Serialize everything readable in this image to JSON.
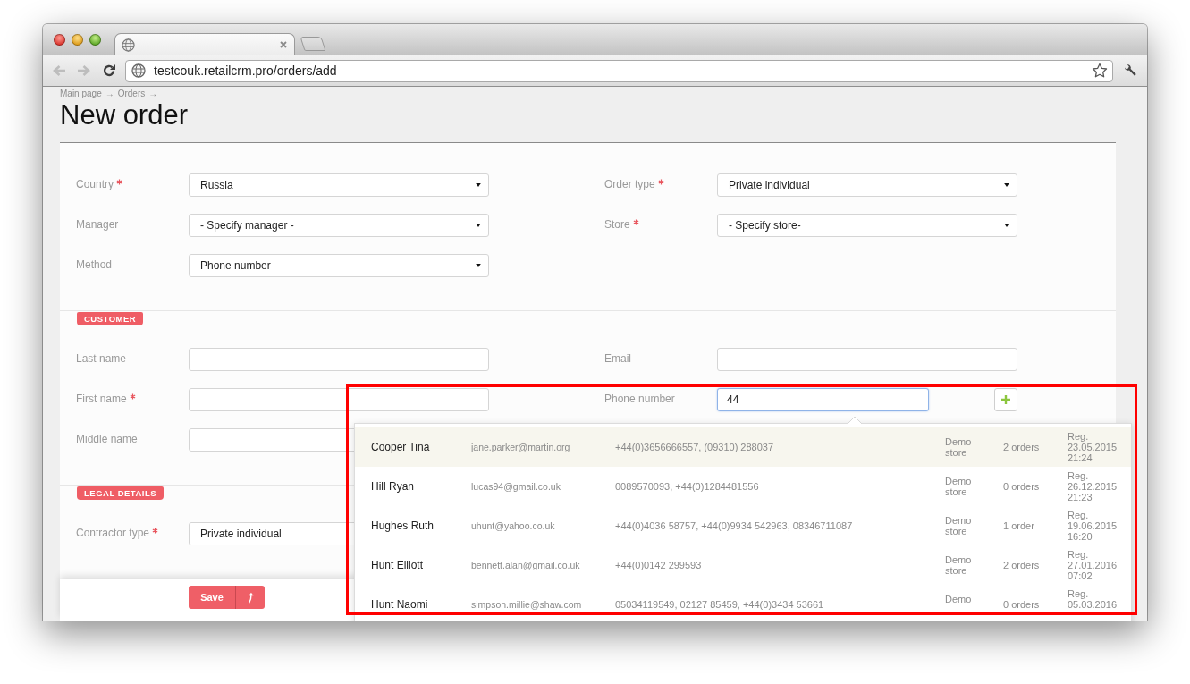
{
  "browser": {
    "tab": {
      "selected": true
    },
    "back": {
      "disabled": true
    },
    "forward": {
      "disabled": true
    },
    "url": "testcouk.retailcrm.pro/orders/add"
  },
  "breadcrumb": {
    "items": [
      "Main page",
      "Orders"
    ],
    "separator": "→"
  },
  "title": "New order",
  "sections": [
    {
      "left": [
        {
          "label": "Country",
          "required": true,
          "kind": "select",
          "value": "Russia"
        },
        {
          "label": "Manager",
          "required": false,
          "kind": "select",
          "value": "- Specify manager -"
        },
        {
          "label": "Method",
          "required": false,
          "kind": "select",
          "value": "Phone number"
        }
      ],
      "right": [
        {
          "label": "Order type",
          "required": true,
          "kind": "select",
          "value": "Private individual"
        },
        {
          "label": "Store",
          "required": true,
          "kind": "select",
          "value": "- Specify store-"
        }
      ]
    },
    {
      "ribbon": "CUSTOMER",
      "left": [
        {
          "label": "Last name",
          "required": false,
          "kind": "input",
          "focused": false
        },
        {
          "label": "First name",
          "required": true,
          "kind": "input",
          "focused": false
        },
        {
          "label": "Middle name",
          "required": false,
          "kind": "input",
          "focused": false
        }
      ],
      "right": [
        {
          "label": "Email",
          "required": false,
          "kind": "input",
          "focused": false
        },
        {
          "label": "Phone number",
          "required": false,
          "kind": "input",
          "value": "44",
          "focused": true,
          "add_button": true
        }
      ]
    },
    {
      "ribbon": "LEGAL DETAILS",
      "left": [
        {
          "label": "Contractor type",
          "required": true,
          "kind": "select",
          "value": "Private individual"
        }
      ]
    }
  ],
  "suggestions": [
    {
      "name": "Cooper Tina",
      "email": "jane.parker@martin.org",
      "phones": "+44(0)3656666557, (09310) 288037",
      "store": "Demo store",
      "orders": "2 orders",
      "registered": "Reg. 23.05.2015 21:24",
      "selected": true
    },
    {
      "name": "Hill Ryan",
      "email": "lucas94@gmail.co.uk",
      "phones": "0089570093, +44(0)1284481556",
      "store": "Demo store",
      "orders": "0 orders",
      "registered": "Reg. 26.12.2015 21:23",
      "selected": false
    },
    {
      "name": "Hughes Ruth",
      "email": "uhunt@yahoo.co.uk",
      "phones": "+44(0)4036 58757, +44(0)9934 542963, 08346711087",
      "store": "Demo store",
      "orders": "1 order",
      "registered": "Reg. 19.06.2015 16:20",
      "selected": false
    },
    {
      "name": "Hunt Elliott",
      "email": "bennett.alan@gmail.co.uk",
      "phones": "+44(0)0142 299593",
      "store": "Demo store",
      "orders": "2 orders",
      "registered": "Reg. 27.01.2016 07:02",
      "selected": false
    },
    {
      "name": "Hunt Naomi",
      "email": "simpson.millie@shaw.com",
      "phones": "05034119549, 02127 85459, +44(0)3434 53661",
      "store": "Demo",
      "orders": "0 orders",
      "registered": "Reg. 05.03.2016",
      "selected": false
    }
  ],
  "save_button": {
    "label": "Save"
  }
}
